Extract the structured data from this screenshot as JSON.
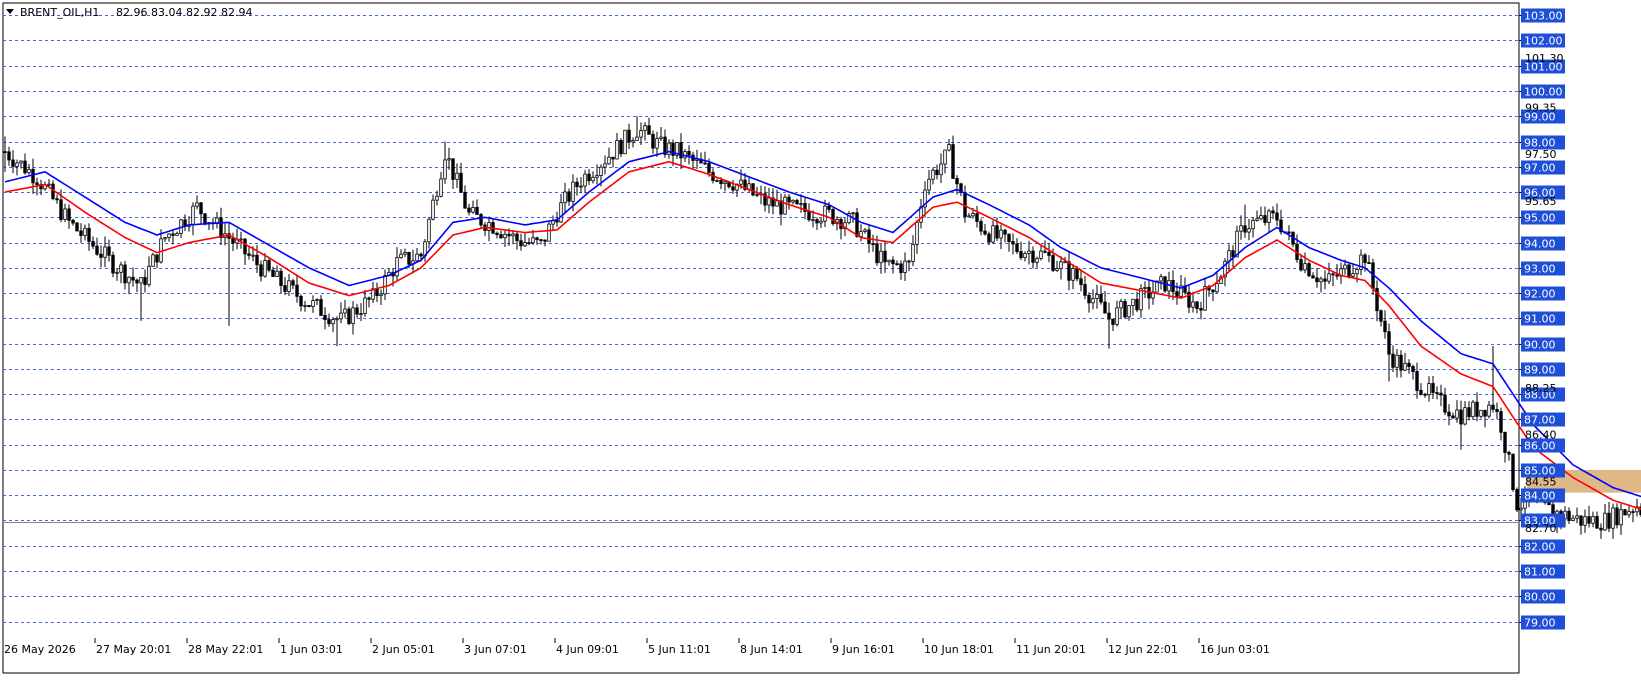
{
  "header": {
    "symbol": "BRENT_OIL,H1",
    "ohlc": "82.96 83.04 82.92 82.94"
  },
  "colors": {
    "background": "#ffffff",
    "grid": "#4169e1",
    "candle": "#000000",
    "ma_fast": "#ff0000",
    "ma_slow": "#0000ff",
    "zone": "#deb887",
    "price_box": "#1e4fd6"
  },
  "chart_data": {
    "type": "candlestick",
    "ylim": [
      78.5,
      103.5
    ],
    "grid": "horizontal-dashed",
    "y_grid_levels": [
      103,
      102,
      101,
      100,
      99,
      98,
      97,
      96,
      95,
      94,
      93,
      92,
      91,
      90,
      89,
      88,
      87,
      86,
      85,
      84,
      83,
      82,
      81,
      80,
      79
    ],
    "y_tick_labels": [
      "103.00",
      "102.00",
      "101.00",
      "100.00",
      "99.00",
      "98.00",
      "97.00",
      "96.00",
      "95.00",
      "94.00",
      "93.00",
      "92.00",
      "91.00",
      "90.00",
      "89.00",
      "88.00",
      "87.00",
      "86.00",
      "85.00",
      "84.00",
      "83.00",
      "82.00",
      "81.00",
      "80.00",
      "79.00"
    ],
    "y_minor_labels": [
      {
        "value": 101.3,
        "text": "101.30"
      },
      {
        "value": 99.35,
        "text": "99.35"
      },
      {
        "value": 97.5,
        "text": "97.50"
      },
      {
        "value": 95.65,
        "text": "95.65"
      },
      {
        "value": 88.25,
        "text": "88.25"
      },
      {
        "value": 86.4,
        "text": "86.40"
      },
      {
        "value": 84.55,
        "text": "84.55"
      },
      {
        "value": 82.7,
        "text": "82.70"
      }
    ],
    "x_labels": [
      "26 May 2026",
      "27 May 20:01",
      "28 May 22:01",
      "1 Jun 03:01",
      "2 Jun 05:01",
      "3 Jun 07:01",
      "4 Jun 09:01",
      "5 Jun 11:01",
      "8 Jun 14:01",
      "9 Jun 16:01",
      "10 Jun 18:01",
      "11 Jun 20:01",
      "12 Jun 22:01",
      "16 Jun 03:01"
    ],
    "bars_per_label": 23,
    "close_path": [
      [
        0,
        97.6
      ],
      [
        8,
        96.6
      ],
      [
        16,
        94.8
      ],
      [
        26,
        93.3
      ],
      [
        34,
        92.3
      ],
      [
        40,
        94.2
      ],
      [
        48,
        95.4
      ],
      [
        56,
        94.2
      ],
      [
        62,
        93.3
      ],
      [
        68,
        92.5
      ],
      [
        76,
        91.6
      ],
      [
        84,
        90.9
      ],
      [
        92,
        91.8
      ],
      [
        98,
        93.2
      ],
      [
        104,
        93.5
      ],
      [
        110,
        97.6
      ],
      [
        116,
        95.1
      ],
      [
        122,
        94.7
      ],
      [
        128,
        94.1
      ],
      [
        134,
        93.9
      ],
      [
        138,
        95.2
      ],
      [
        144,
        96.5
      ],
      [
        152,
        97.6
      ],
      [
        158,
        98.5
      ],
      [
        164,
        97.8
      ],
      [
        168,
        97.6
      ],
      [
        176,
        96.8
      ],
      [
        182,
        96.4
      ],
      [
        190,
        95.6
      ],
      [
        198,
        95.3
      ],
      [
        206,
        95.1
      ],
      [
        212,
        94.8
      ],
      [
        220,
        93.1
      ],
      [
        226,
        93.1
      ],
      [
        230,
        96.4
      ],
      [
        236,
        97.5
      ],
      [
        240,
        95.2
      ],
      [
        246,
        94.4
      ],
      [
        252,
        93.8
      ],
      [
        260,
        93.5
      ],
      [
        268,
        92.6
      ],
      [
        276,
        91.0
      ],
      [
        282,
        91.6
      ],
      [
        290,
        92.4
      ],
      [
        298,
        91.5
      ],
      [
        304,
        92.8
      ],
      [
        310,
        94.7
      ],
      [
        318,
        95.0
      ],
      [
        324,
        93.3
      ],
      [
        330,
        92.4
      ],
      [
        336,
        93.0
      ],
      [
        340,
        93.5
      ],
      [
        346,
        89.6
      ],
      [
        352,
        88.7
      ],
      [
        358,
        87.7
      ],
      [
        364,
        87.2
      ],
      [
        372,
        87.6
      ],
      [
        374,
        86.8
      ],
      [
        378,
        83.7
      ],
      [
        386,
        83.4
      ],
      [
        394,
        83.0
      ],
      [
        400,
        83.0
      ],
      [
        408,
        83.6
      ],
      [
        412,
        83.0
      ]
    ],
    "range_points": [
      [
        0,
        98.2,
        96.8
      ],
      [
        34,
        90.9,
        null
      ],
      [
        56,
        null,
        90.7
      ],
      [
        83,
        null,
        89.9
      ],
      [
        110,
        98.0,
        null
      ],
      [
        158,
        99.0,
        null
      ],
      [
        220,
        null,
        92.8
      ],
      [
        236,
        98.1,
        null
      ],
      [
        276,
        null,
        89.8
      ],
      [
        310,
        95.5,
        null
      ],
      [
        346,
        null,
        88.5
      ],
      [
        364,
        null,
        85.8
      ],
      [
        372,
        89.9,
        null
      ],
      [
        388,
        null,
        82.5
      ]
    ],
    "series": [
      {
        "type": "ma",
        "period": 20,
        "color": "#ff0000",
        "values": [
          [
            0,
            96.0
          ],
          [
            10,
            96.3
          ],
          [
            20,
            95.2
          ],
          [
            30,
            94.2
          ],
          [
            38,
            93.6
          ],
          [
            46,
            94.0
          ],
          [
            56,
            94.3
          ],
          [
            66,
            93.4
          ],
          [
            76,
            92.4
          ],
          [
            86,
            91.9
          ],
          [
            96,
            92.3
          ],
          [
            104,
            93.0
          ],
          [
            112,
            94.3
          ],
          [
            120,
            94.6
          ],
          [
            130,
            94.4
          ],
          [
            138,
            94.5
          ],
          [
            146,
            95.6
          ],
          [
            156,
            96.8
          ],
          [
            166,
            97.2
          ],
          [
            176,
            96.7
          ],
          [
            186,
            96.1
          ],
          [
            196,
            95.5
          ],
          [
            206,
            95.0
          ],
          [
            214,
            94.2
          ],
          [
            222,
            94.0
          ],
          [
            232,
            95.4
          ],
          [
            238,
            95.6
          ],
          [
            246,
            95.0
          ],
          [
            256,
            94.2
          ],
          [
            264,
            93.4
          ],
          [
            274,
            92.4
          ],
          [
            284,
            92.1
          ],
          [
            294,
            91.8
          ],
          [
            302,
            92.3
          ],
          [
            310,
            93.4
          ],
          [
            318,
            94.1
          ],
          [
            326,
            93.3
          ],
          [
            334,
            92.7
          ],
          [
            340,
            92.5
          ],
          [
            346,
            91.5
          ],
          [
            354,
            89.9
          ],
          [
            364,
            88.8
          ],
          [
            372,
            88.3
          ],
          [
            382,
            85.9
          ],
          [
            392,
            84.7
          ],
          [
            402,
            83.8
          ],
          [
            412,
            83.3
          ]
        ]
      },
      {
        "type": "ma",
        "period": 20,
        "color": "#0000ff",
        "values": [
          [
            0,
            96.4
          ],
          [
            10,
            96.8
          ],
          [
            20,
            95.8
          ],
          [
            30,
            94.8
          ],
          [
            38,
            94.3
          ],
          [
            46,
            94.7
          ],
          [
            56,
            94.8
          ],
          [
            66,
            93.9
          ],
          [
            76,
            93.0
          ],
          [
            86,
            92.3
          ],
          [
            96,
            92.7
          ],
          [
            104,
            93.3
          ],
          [
            112,
            94.8
          ],
          [
            120,
            95.0
          ],
          [
            130,
            94.7
          ],
          [
            138,
            94.9
          ],
          [
            146,
            96.0
          ],
          [
            156,
            97.2
          ],
          [
            166,
            97.6
          ],
          [
            176,
            97.2
          ],
          [
            186,
            96.6
          ],
          [
            196,
            96.0
          ],
          [
            206,
            95.5
          ],
          [
            214,
            94.8
          ],
          [
            222,
            94.4
          ],
          [
            232,
            95.8
          ],
          [
            238,
            96.1
          ],
          [
            246,
            95.5
          ],
          [
            256,
            94.7
          ],
          [
            264,
            93.8
          ],
          [
            274,
            93.0
          ],
          [
            284,
            92.6
          ],
          [
            294,
            92.2
          ],
          [
            302,
            92.7
          ],
          [
            310,
            93.8
          ],
          [
            318,
            94.6
          ],
          [
            326,
            93.8
          ],
          [
            334,
            93.3
          ],
          [
            340,
            93.0
          ],
          [
            346,
            92.2
          ],
          [
            354,
            90.9
          ],
          [
            364,
            89.6
          ],
          [
            372,
            89.2
          ],
          [
            382,
            86.8
          ],
          [
            392,
            85.2
          ],
          [
            402,
            84.3
          ],
          [
            412,
            83.8
          ]
        ]
      }
    ],
    "zone": {
      "x_start": 381,
      "x_end": 445,
      "y_low": 84.1,
      "y_high": 85.0
    },
    "current_price": 82.94
  }
}
